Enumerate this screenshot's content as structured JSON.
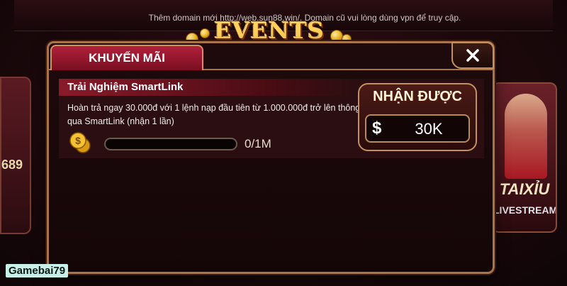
{
  "background": {
    "notice": "Thêm domain mới http://web.sun88.win/. Domain cũ vui lòng dùng vpn để truy cập.",
    "left_card_number": "689",
    "right_card_title": "TAIXỈU",
    "right_card_subtitle": "LIVESTREAM"
  },
  "banner": {
    "title": "EVENTS"
  },
  "modal": {
    "tab_label": "KHUYẾN MÃI",
    "close_icon": "close-icon"
  },
  "promo": {
    "title": "Trải Nghiệm SmartLink",
    "description": "Hoàn trả ngay 30.000đ với 1 lệnh nạp đầu tiên từ 1.000.000đ trở lên thông qua SmartLink (nhận 1 lần)",
    "progress_fraction": 0,
    "progress_text": "0/1M",
    "reward_label": "NHẬN ĐƯỢC",
    "reward_currency": "$",
    "reward_value": "30K"
  },
  "watermark": "Gamebai79",
  "colors": {
    "accent_red": "#b0203a",
    "gold": "#c49060"
  }
}
